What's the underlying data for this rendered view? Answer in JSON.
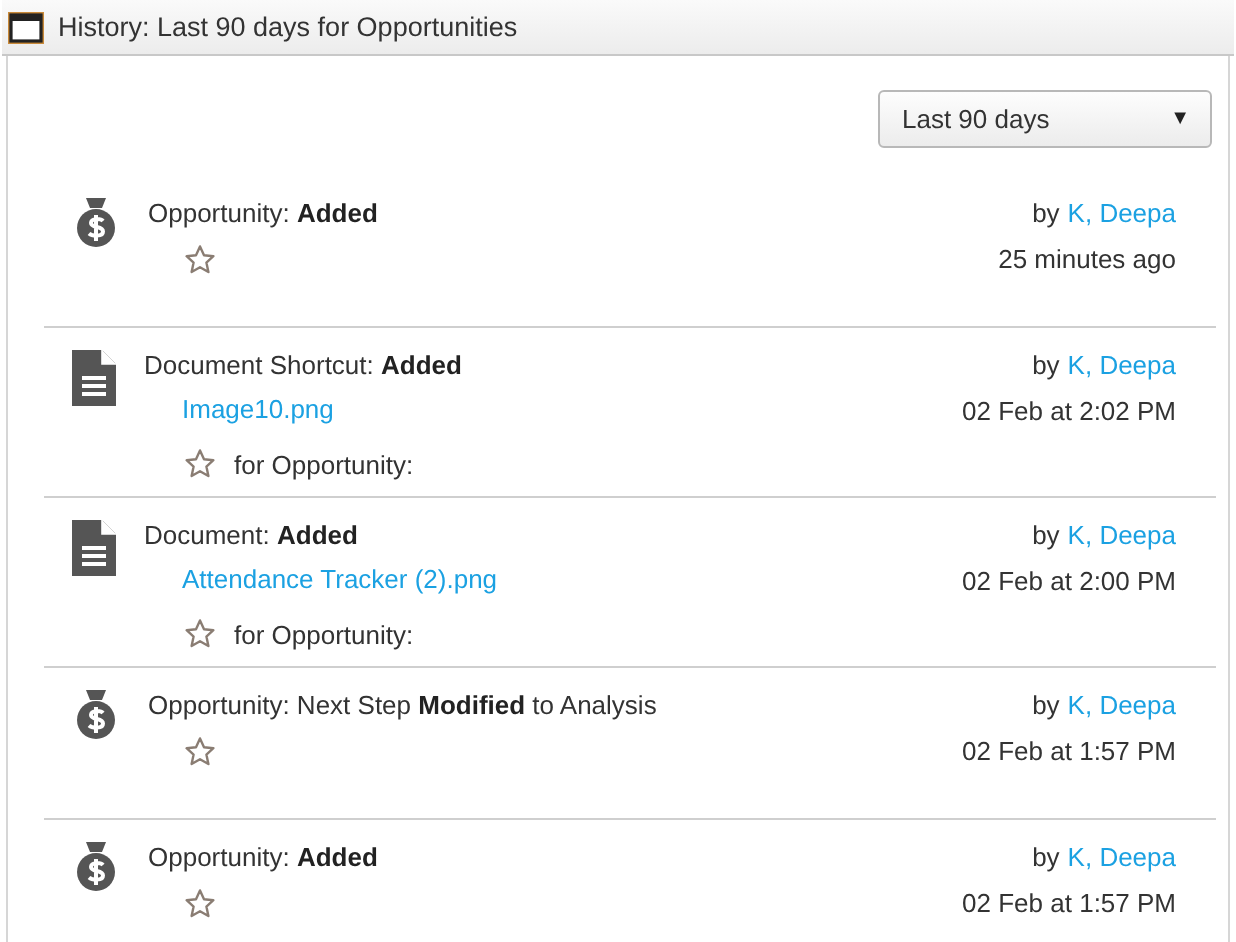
{
  "panel": {
    "title": "History: Last 90 days for Opportunities"
  },
  "filter": {
    "value": "Last 90 days",
    "arrow": "▼"
  },
  "entries": [
    {
      "kind": "opportunity",
      "title": "Opportunity: **Added**",
      "starred": false,
      "by": "by",
      "author": "K, Deepa",
      "time": "25 minutes ago"
    },
    {
      "kind": "document",
      "title": "Document Shortcut: **Added**",
      "link": "Image10.png",
      "starred": false,
      "context": "for Opportunity:",
      "by": "by",
      "author": "K, Deepa",
      "time": "02 Feb at 2:02 PM"
    },
    {
      "kind": "document",
      "title": "Document: **Added**",
      "link": "Attendance Tracker (2).png",
      "starred": false,
      "context": "for Opportunity:",
      "by": "by",
      "author": "K, Deepa",
      "time": "02 Feb at 2:00 PM"
    },
    {
      "kind": "opportunity",
      "title": "Opportunity: Next Step **Modified** to Analysis",
      "starred": false,
      "by": "by",
      "author": "K, Deepa",
      "time": "02 Feb at 1:57 PM"
    },
    {
      "kind": "opportunity",
      "title": "Opportunity: **Added**",
      "starred": false,
      "by": "by",
      "author": "K, Deepa",
      "time": "02 Feb at 1:57 PM"
    }
  ]
}
